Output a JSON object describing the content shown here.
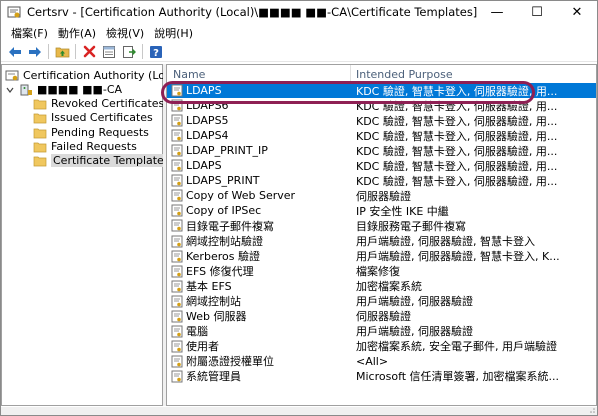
{
  "window": {
    "title": "Certsrv - [Certification Authority (Local)\\■■■■ ■■-CA\\Certificate Templates]",
    "minimize": "—",
    "maximize": "☐",
    "close": "✕"
  },
  "menu": [
    "檔案(F)",
    "動作(A)",
    "檢視(V)",
    "說明(H)"
  ],
  "toolbar": {
    "back": "back-arrow-icon",
    "forward": "forward-arrow-icon",
    "up": "folder-up-icon",
    "delete": "delete-icon",
    "properties": "properties-icon",
    "export": "export-list-icon",
    "help": "help-icon",
    "help_glyph": "?"
  },
  "tree": {
    "root": "Certification Authority (Local)",
    "ca": "■■■■ ■■-CA",
    "children": [
      "Revoked Certificates",
      "Issued Certificates",
      "Pending Requests",
      "Failed Requests",
      "Certificate Templates"
    ],
    "selected": "Certificate Templates"
  },
  "list": {
    "columns": {
      "name": "Name",
      "purpose": "Intended Purpose"
    },
    "rows": [
      {
        "name": "LDAPS",
        "purpose": "KDC 驗證, 智慧卡登入, 伺服器驗證, 用...",
        "selected": true
      },
      {
        "name": "LDAPS6",
        "purpose": "KDC 驗證, 智慧卡登入, 伺服器驗證, 用..."
      },
      {
        "name": "LDAPS5",
        "purpose": "KDC 驗證, 智慧卡登入, 伺服器驗證, 用..."
      },
      {
        "name": "LDAPS4",
        "purpose": "KDC 驗證, 智慧卡登入, 伺服器驗證, 用..."
      },
      {
        "name": "LDAP_PRINT_IP",
        "purpose": "KDC 驗證, 智慧卡登入, 伺服器驗證, 用..."
      },
      {
        "name": "LDAPS",
        "purpose": "KDC 驗證, 智慧卡登入, 伺服器驗證, 用..."
      },
      {
        "name": "LDAPS_PRINT",
        "purpose": "KDC 驗證, 智慧卡登入, 伺服器驗證, 用..."
      },
      {
        "name": "Copy of Web Server",
        "purpose": "伺服器驗證"
      },
      {
        "name": "Copy of IPSec",
        "purpose": "IP 安全性 IKE 中繼"
      },
      {
        "name": "目錄電子郵件複寫",
        "purpose": "目錄服務電子郵件複寫"
      },
      {
        "name": "網域控制站驗證",
        "purpose": "用戶端驗證, 伺服器驗證, 智慧卡登入"
      },
      {
        "name": "Kerberos 驗證",
        "purpose": "用戶端驗證, 伺服器驗證, 智慧卡登入, K..."
      },
      {
        "name": "EFS 修復代理",
        "purpose": "檔案修復"
      },
      {
        "name": "基本 EFS",
        "purpose": "加密檔案系統"
      },
      {
        "name": "網域控制站",
        "purpose": "用戶端驗證, 伺服器驗證"
      },
      {
        "name": "Web 伺服器",
        "purpose": "伺服器驗證"
      },
      {
        "name": "電腦",
        "purpose": "用戶端驗證, 伺服器驗證"
      },
      {
        "name": "使用者",
        "purpose": "加密檔案系統, 安全電子郵件, 用戶端驗證"
      },
      {
        "name": "附屬憑證授權單位",
        "purpose": "<All>"
      },
      {
        "name": "系統管理員",
        "purpose": "Microsoft 信任清單簽署, 加密檔案系統..."
      }
    ]
  },
  "colors": {
    "selection": "#0078d7",
    "annotation_outline": "#8e2054"
  }
}
